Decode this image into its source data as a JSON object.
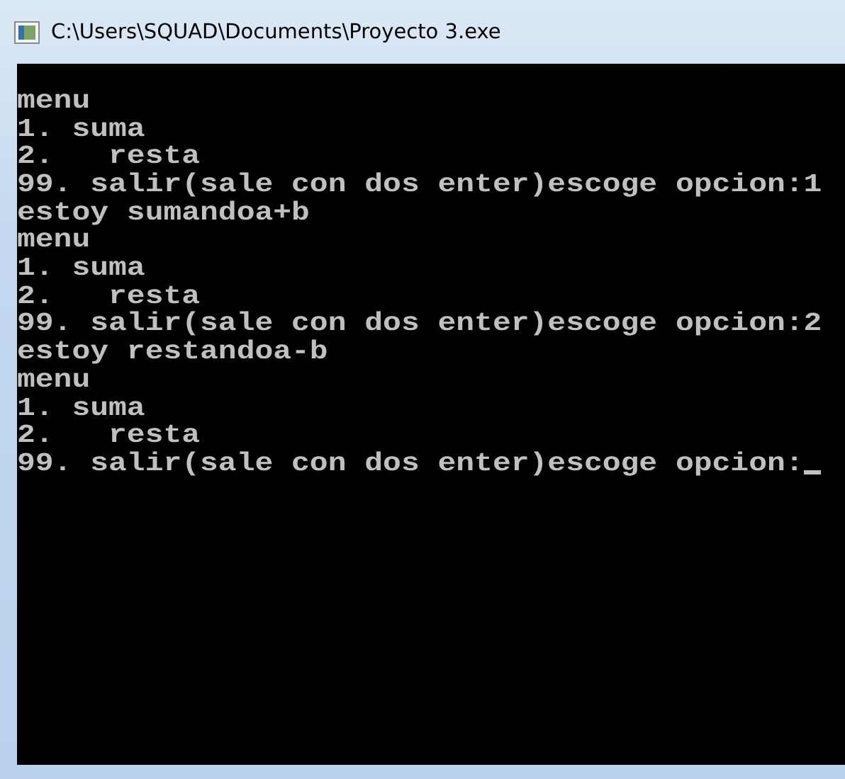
{
  "window": {
    "title": "C:\\Users\\SQUAD\\Documents\\Proyecto 3.exe"
  },
  "console": {
    "lines": [
      "menu",
      "1. suma",
      "2.   resta",
      "99. salir(sale con dos enter)escoge opcion:1",
      "estoy sumandoa+b",
      "menu",
      "1. suma",
      "2.   resta",
      "99. salir(sale con dos enter)escoge opcion:2",
      "estoy restandoa-b",
      "menu",
      "1. suma",
      "2.   resta",
      "99. salir(sale con dos enter)escoge opcion:"
    ],
    "cursor_visible": true
  }
}
